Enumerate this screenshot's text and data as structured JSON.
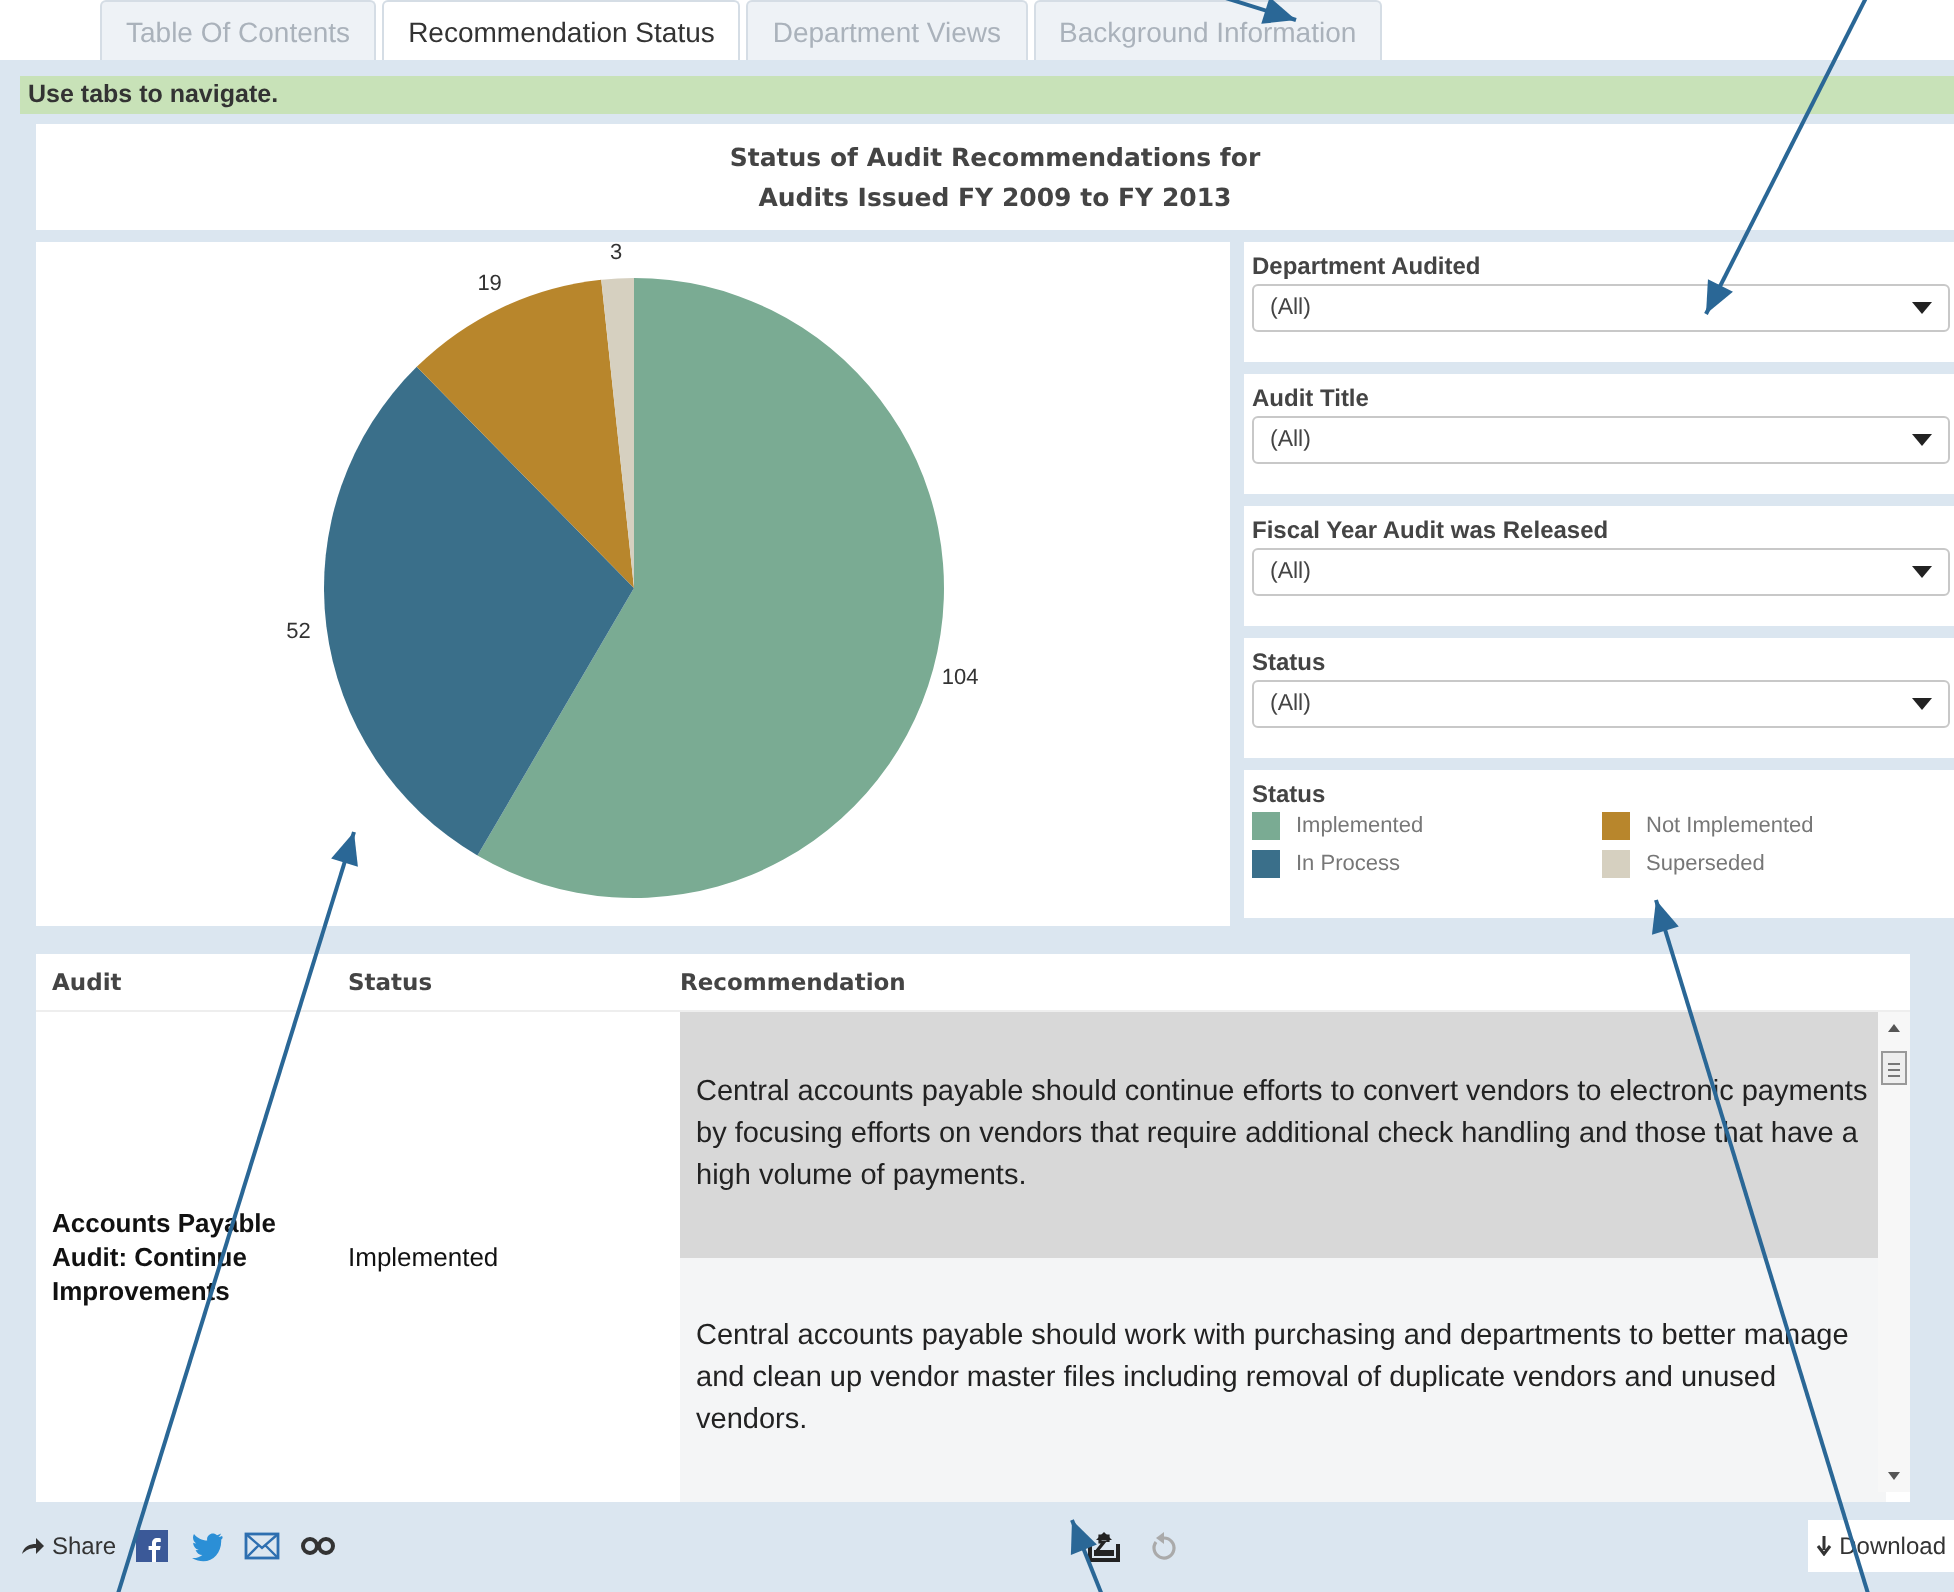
{
  "tabs": [
    {
      "label": "Table Of Contents",
      "selected": false
    },
    {
      "label": "Recommendation Status",
      "selected": true
    },
    {
      "label": "Department Views",
      "selected": false
    },
    {
      "label": "Background Information",
      "selected": false
    }
  ],
  "hint_bar": "Use tabs to navigate.",
  "title_lines": [
    "Status of Audit Recommendations for",
    "Audits Issued FY 2009 to FY 2013"
  ],
  "chart": {
    "chart_data": {
      "type": "pie",
      "categories": [
        "Implemented",
        "In Process",
        "Not Implemented",
        "Superseded"
      ],
      "values": [
        104,
        52,
        19,
        3
      ],
      "data_labels": true
    }
  },
  "filters": [
    {
      "label": "Department Audited",
      "value": "(All)"
    },
    {
      "label": "Audit Title",
      "value": "(All)"
    },
    {
      "label": "Fiscal Year Audit was Released",
      "value": "(All)"
    },
    {
      "label": "Status",
      "value": "(All)"
    }
  ],
  "legend": {
    "title": "Status",
    "items": [
      {
        "color": "#7aab93"
      },
      {
        "color": "#3a6f8a"
      },
      {
        "color": "#b8862c"
      },
      {
        "color": "#d6d0c0"
      }
    ]
  },
  "table": {
    "columns": [
      "Audit",
      "Status",
      "Recommendation"
    ],
    "rows": [
      {
        "audit": "Accounts Payable Audit:  Continue Improvements",
        "status": "Implemented",
        "recommendations": [
          "Central accounts payable should continue efforts to convert vendors to electronic payments by focusing efforts on vendors that require additional check handling and those that have a high volume of payments.",
          "Central accounts payable should work with purchasing and departments to better manage and clean up vendor master files including removal of duplicate vendors and unused vendors."
        ]
      }
    ]
  },
  "toolbar": {
    "share": "Share",
    "download": "Download"
  }
}
